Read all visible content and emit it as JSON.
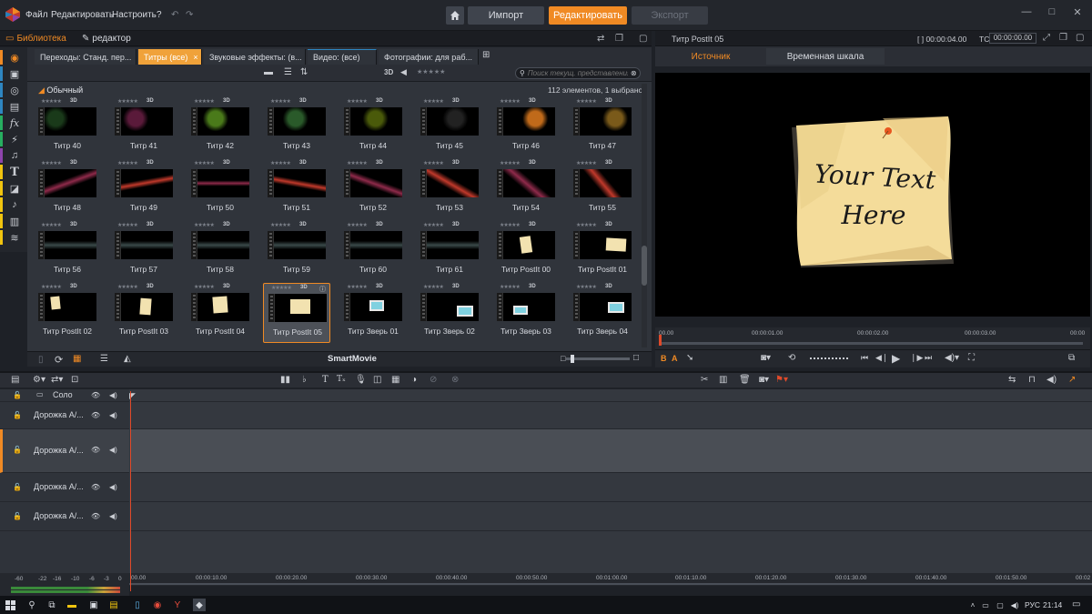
{
  "menu": {
    "file": "Файл",
    "edit": "Редактировать",
    "settings": "Настроить"
  },
  "modes": {
    "import": "Импорт",
    "edit": "Редактировать",
    "export": "Экспорт"
  },
  "library": {
    "tab_library": "Библиотека",
    "tab_editor": "редактор",
    "content_tabs": [
      "Переходы: Станд. пер...",
      "Титры (все)",
      "Звуковые эффекты: (в...",
      "Видео: (все)",
      "Фотографии: для раб..."
    ],
    "search_placeholder": "Поиск текущ. представления",
    "toolbar_3d": "3D",
    "group_label": "Обычный",
    "count_label": "112 элементов, 1 выбрано",
    "bottom_label": "SmartMovie",
    "rows": [
      [
        "Титр 40",
        "Титр 41",
        "Титр 42",
        "Титр 43",
        "Титр 44",
        "Титр 45",
        "Титр 46",
        "Титр 47"
      ],
      [
        "Титр 48",
        "Титр 49",
        "Титр 50",
        "Титр 51",
        "Титр 52",
        "Титр 53",
        "Титр 54",
        "Титр 55"
      ],
      [
        "Титр 56",
        "Титр 57",
        "Титр 58",
        "Титр 59",
        "Титр 60",
        "Титр 61",
        "Титр PostIt 00",
        "Титр PostIt 01"
      ],
      [
        "Титр PostIt 02",
        "Титр PostIt 03",
        "Титр PostIt 04",
        "Титр PostIt 05",
        "Титр Зверь 01",
        "Титр Зверь 02",
        "Титр Зверь 03",
        "Титр Зверь 04"
      ]
    ],
    "selected_item": "Титр PostIt 05",
    "tag_3d": "3D"
  },
  "preview": {
    "title": "Титр PostIt 05",
    "duration": "[ ] 00:00:04.00",
    "tc_label": "TC",
    "tc_value": "00:00:00.00",
    "tab_source": "Источник",
    "tab_timeline": "Временная шкала",
    "postit_text_line1": "Your Text",
    "postit_text_line2": "Here",
    "ruler": [
      "00.00",
      "00:00:01.00",
      "00:00:02.00",
      "00:00:03.00",
      "00:00"
    ],
    "label_b": "B",
    "label_a": "A"
  },
  "timeline": {
    "tracks": [
      {
        "name": "Соло"
      },
      {
        "name": "Дорожка А/..."
      },
      {
        "name": "Дорожка А/..."
      },
      {
        "name": "Дорожка А/..."
      },
      {
        "name": "Дорожка А/..."
      }
    ],
    "ruler": [
      "00.00",
      "00:00:10.00",
      "00:00:20.00",
      "00:00:30.00",
      "00:00:40.00",
      "00:00:50.00",
      "00:01:00.00",
      "00:01:10.00",
      "00:01:20.00",
      "00:01:30.00",
      "00:01:40.00",
      "00:01:50.00",
      "00:02"
    ],
    "vu_scale": [
      "-60",
      "-22",
      "-16",
      "-10",
      "-6",
      "-3",
      "0"
    ]
  },
  "taskbar": {
    "lang": "РУС",
    "time": "21:14"
  },
  "colors": {
    "accent": "#f08a24",
    "bg": "#1e2127",
    "panel": "#2b2e35"
  }
}
